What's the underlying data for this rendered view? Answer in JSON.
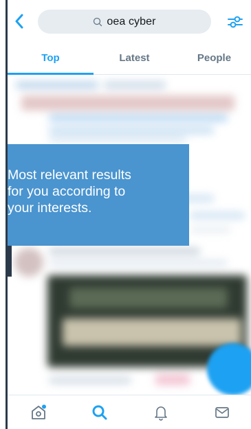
{
  "search": {
    "query": "oea cyber"
  },
  "tabs": [
    {
      "label": "Top",
      "active": true
    },
    {
      "label": "Latest",
      "active": false
    },
    {
      "label": "People",
      "active": false
    }
  ],
  "callout": {
    "lines": [
      "Most relevant results",
      "for you according to",
      "your interests."
    ]
  },
  "icons": {
    "back": "chevron-left-icon",
    "filter": "sliders-icon",
    "search": "search-icon",
    "home": "home-icon",
    "explore": "search-icon",
    "notifications": "bell-icon",
    "messages": "envelope-icon"
  },
  "colors": {
    "accent": "#1da1f2",
    "callout": "#4a94cf",
    "search_bg": "#e6ecf0"
  }
}
